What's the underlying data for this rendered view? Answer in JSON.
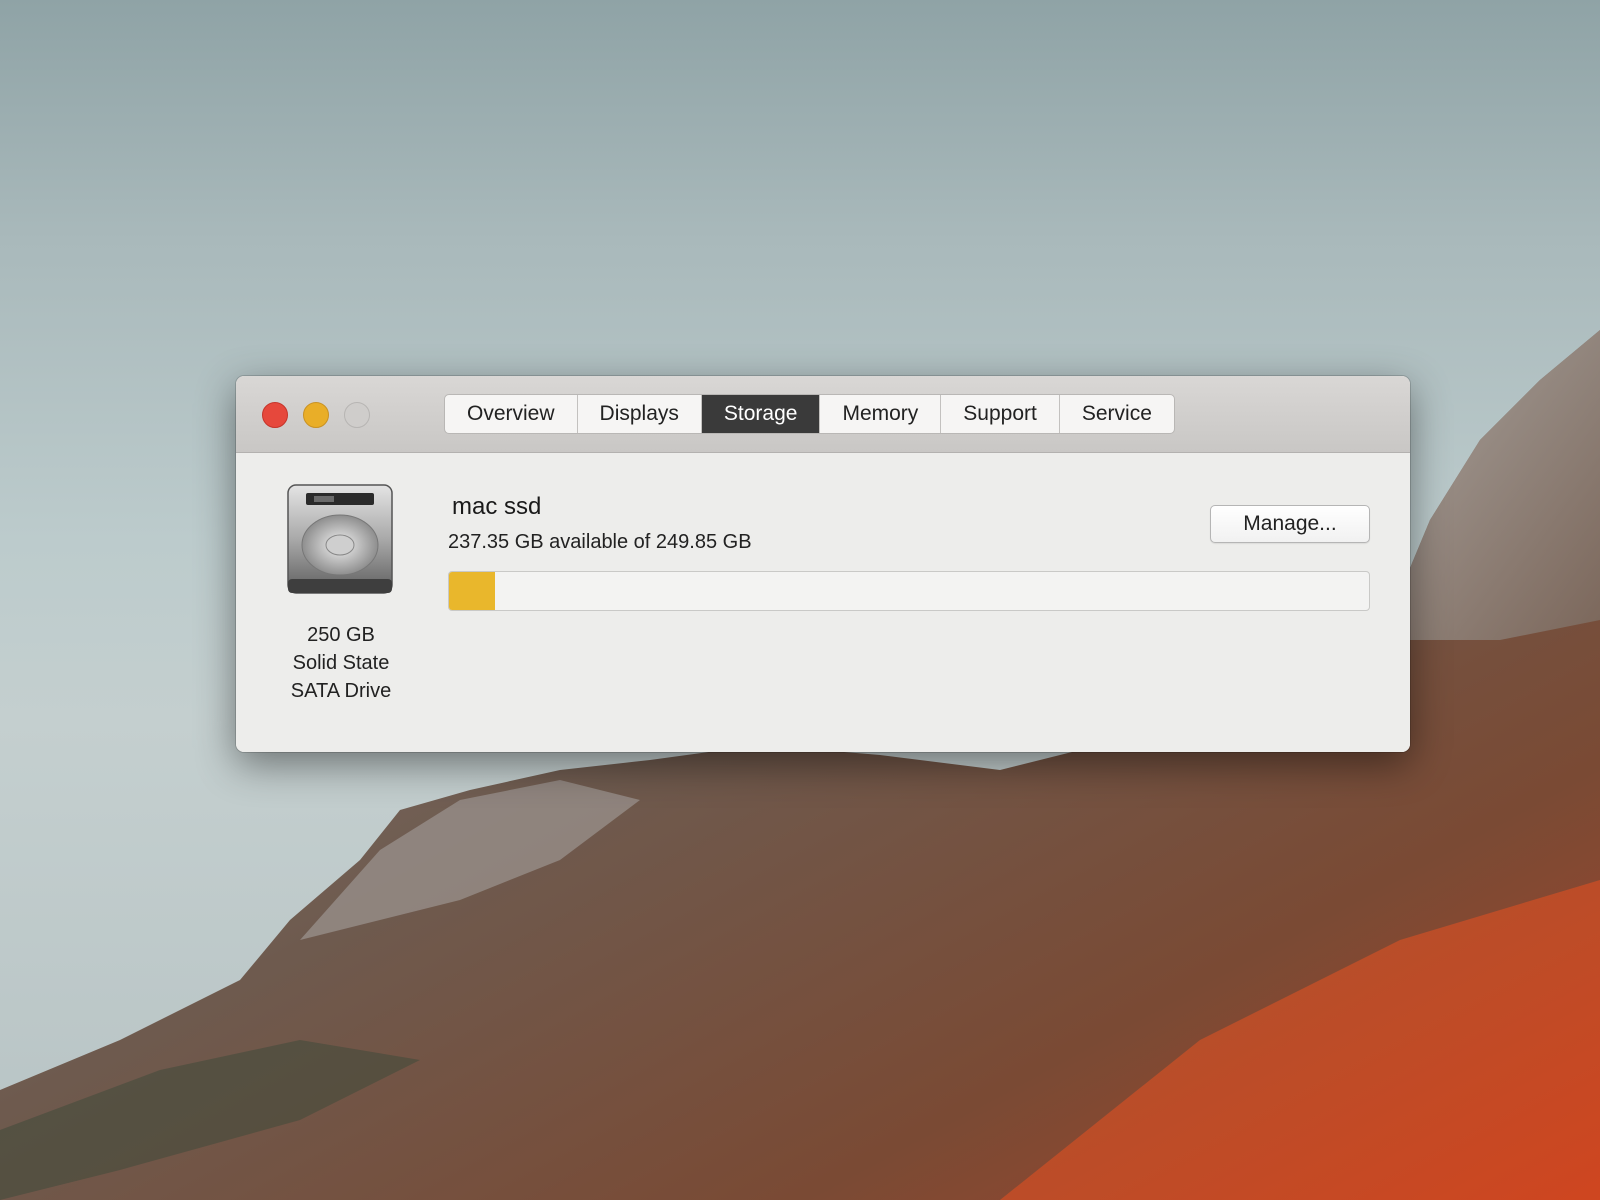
{
  "window": {
    "tabs": [
      {
        "label": "Overview"
      },
      {
        "label": "Displays"
      },
      {
        "label": "Storage",
        "active": true
      },
      {
        "label": "Memory"
      },
      {
        "label": "Support"
      },
      {
        "label": "Service"
      }
    ]
  },
  "storage": {
    "drive_name": "mac ssd",
    "available_text": "237.35 GB available of 249.85 GB",
    "used_fraction": 0.05,
    "used_color": "#e9b72c",
    "manage_label": "Manage...",
    "drive_icon": "hard-drive-icon",
    "caption": {
      "line1": "250 GB",
      "line2": "Solid State",
      "line3": "SATA Drive"
    }
  }
}
